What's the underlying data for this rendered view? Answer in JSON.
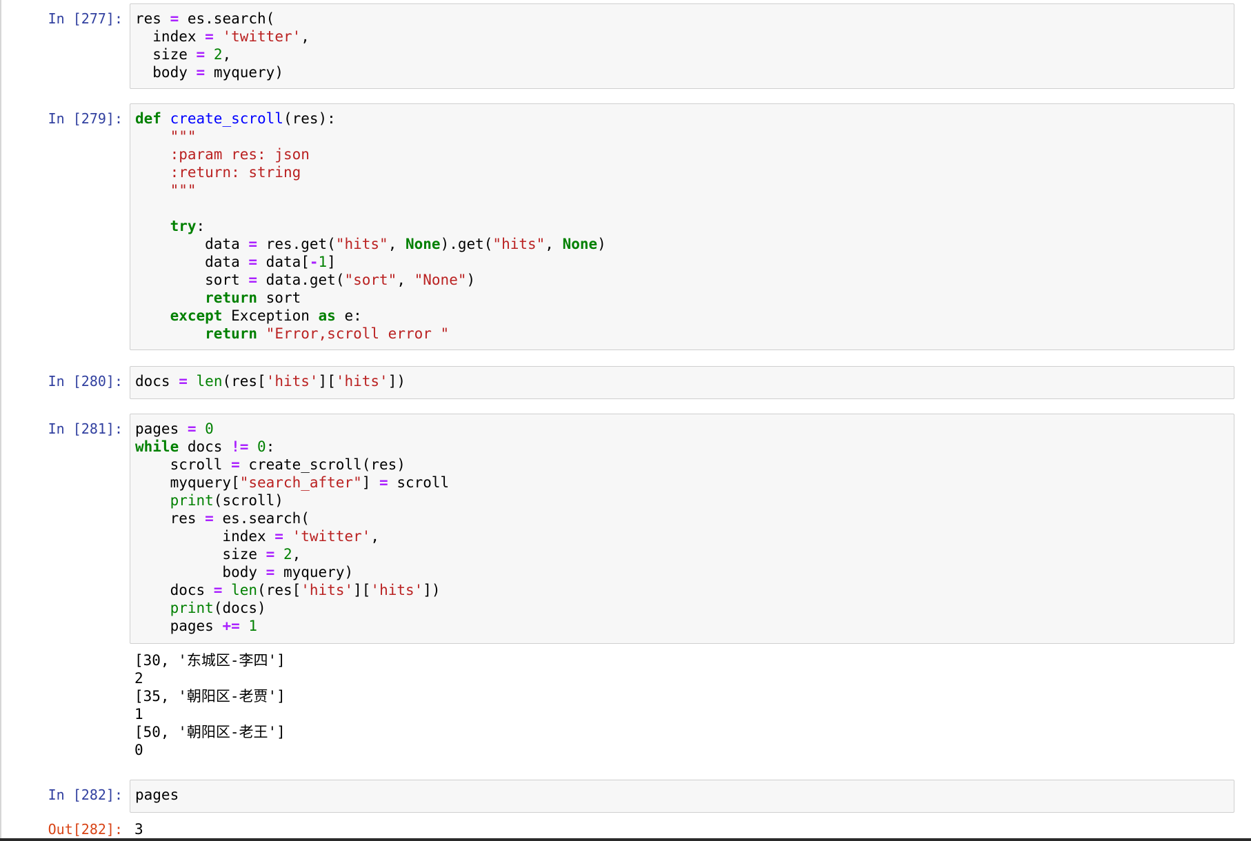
{
  "cells": [
    {
      "prompt": "In [277]:",
      "code": [
        [
          [
            "res "
          ],
          [
            "=",
            "op"
          ],
          [
            " es.search("
          ]
        ],
        [
          [
            "  index "
          ],
          [
            "=",
            "op"
          ],
          [
            " "
          ],
          [
            "'twitter'",
            "str"
          ],
          [
            ","
          ]
        ],
        [
          [
            "  size "
          ],
          [
            "=",
            "op"
          ],
          [
            " "
          ],
          [
            "2",
            "num"
          ],
          [
            ","
          ]
        ],
        [
          [
            "  body "
          ],
          [
            "=",
            "op"
          ],
          [
            " myquery)"
          ]
        ]
      ]
    },
    {
      "prompt": "In [279]:",
      "code": [
        [
          [
            "def",
            "kw"
          ],
          [
            " "
          ],
          [
            "create_scroll",
            "fn"
          ],
          [
            "(res):"
          ]
        ],
        [
          [
            "    "
          ],
          [
            "\"\"\"",
            "str"
          ]
        ],
        [
          [
            "    "
          ],
          [
            ":param res: json",
            "str"
          ]
        ],
        [
          [
            "    "
          ],
          [
            ":return: string",
            "str"
          ]
        ],
        [
          [
            "    "
          ],
          [
            "\"\"\"",
            "str"
          ]
        ],
        [
          [
            ""
          ]
        ],
        [
          [
            "    "
          ],
          [
            "try",
            "kw"
          ],
          [
            ":"
          ]
        ],
        [
          [
            "        data "
          ],
          [
            "=",
            "op"
          ],
          [
            " res.get("
          ],
          [
            "\"hits\"",
            "str"
          ],
          [
            ", "
          ],
          [
            "None",
            "kw"
          ],
          [
            ").get("
          ],
          [
            "\"hits\"",
            "str"
          ],
          [
            ", "
          ],
          [
            "None",
            "kw"
          ],
          [
            ")"
          ]
        ],
        [
          [
            "        data "
          ],
          [
            "=",
            "op"
          ],
          [
            " data["
          ],
          [
            "-",
            "op"
          ],
          [
            "1",
            "num"
          ],
          [
            "]"
          ]
        ],
        [
          [
            "        sort "
          ],
          [
            "=",
            "op"
          ],
          [
            " data.get("
          ],
          [
            "\"sort\"",
            "str"
          ],
          [
            ", "
          ],
          [
            "\"None\"",
            "str"
          ],
          [
            ")"
          ]
        ],
        [
          [
            "        "
          ],
          [
            "return",
            "kw"
          ],
          [
            " sort"
          ]
        ],
        [
          [
            "    "
          ],
          [
            "except",
            "kw"
          ],
          [
            " Exception "
          ],
          [
            "as",
            "kw"
          ],
          [
            " e:"
          ]
        ],
        [
          [
            "        "
          ],
          [
            "return",
            "kw"
          ],
          [
            " "
          ],
          [
            "\"Error,scroll error \"",
            "str"
          ]
        ]
      ]
    },
    {
      "prompt": "In [280]:",
      "code": [
        [
          [
            "docs "
          ],
          [
            "=",
            "op"
          ],
          [
            " "
          ],
          [
            "len",
            "bi"
          ],
          [
            "(res["
          ],
          [
            "'hits'",
            "str"
          ],
          [
            "]["
          ],
          [
            "'hits'",
            "str"
          ],
          [
            "])"
          ]
        ]
      ]
    },
    {
      "prompt": "In [281]:",
      "code": [
        [
          [
            "pages "
          ],
          [
            "=",
            "op"
          ],
          [
            " "
          ],
          [
            "0",
            "num"
          ]
        ],
        [
          [
            "while",
            "kw"
          ],
          [
            " docs "
          ],
          [
            "!=",
            "op"
          ],
          [
            " "
          ],
          [
            "0",
            "num"
          ],
          [
            ":"
          ]
        ],
        [
          [
            "    scroll "
          ],
          [
            "=",
            "op"
          ],
          [
            " create_scroll(res)"
          ]
        ],
        [
          [
            "    myquery["
          ],
          [
            "\"search_after\"",
            "str"
          ],
          [
            "] "
          ],
          [
            "=",
            "op"
          ],
          [
            " scroll"
          ]
        ],
        [
          [
            "    "
          ],
          [
            "print",
            "bi"
          ],
          [
            "(scroll)"
          ]
        ],
        [
          [
            "    res "
          ],
          [
            "=",
            "op"
          ],
          [
            " es.search("
          ]
        ],
        [
          [
            "          index "
          ],
          [
            "=",
            "op"
          ],
          [
            " "
          ],
          [
            "'twitter'",
            "str"
          ],
          [
            ","
          ]
        ],
        [
          [
            "          size "
          ],
          [
            "=",
            "op"
          ],
          [
            " "
          ],
          [
            "2",
            "num"
          ],
          [
            ","
          ]
        ],
        [
          [
            "          body "
          ],
          [
            "=",
            "op"
          ],
          [
            " myquery)"
          ]
        ],
        [
          [
            "    docs "
          ],
          [
            "=",
            "op"
          ],
          [
            " "
          ],
          [
            "len",
            "bi"
          ],
          [
            "(res["
          ],
          [
            "'hits'",
            "str"
          ],
          [
            "]["
          ],
          [
            "'hits'",
            "str"
          ],
          [
            "])"
          ]
        ],
        [
          [
            "    "
          ],
          [
            "print",
            "bi"
          ],
          [
            "(docs)"
          ]
        ],
        [
          [
            "    pages "
          ],
          [
            "+=",
            "op"
          ],
          [
            " "
          ],
          [
            "1",
            "num"
          ]
        ]
      ],
      "output": [
        "[30, '东城区-李四']",
        "2",
        "[35, '朝阳区-老贾']",
        "1",
        "[50, '朝阳区-老王']",
        "0"
      ]
    },
    {
      "prompt": "In [282]:",
      "code": [
        [
          [
            "pages"
          ]
        ]
      ],
      "out_prompt": "Out[282]:",
      "output": [
        "3"
      ]
    }
  ]
}
